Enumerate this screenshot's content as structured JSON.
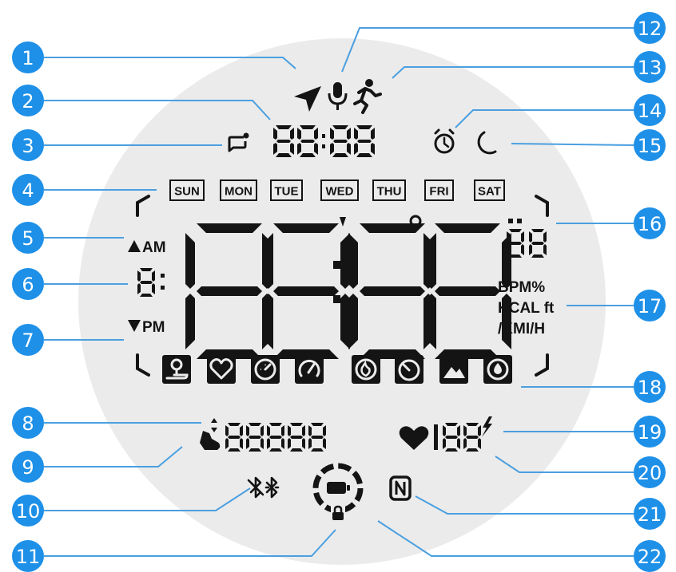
{
  "callouts": [
    {
      "num": "1"
    },
    {
      "num": "2"
    },
    {
      "num": "3"
    },
    {
      "num": "4"
    },
    {
      "num": "5"
    },
    {
      "num": "6"
    },
    {
      "num": "7"
    },
    {
      "num": "8"
    },
    {
      "num": "9"
    },
    {
      "num": "10"
    },
    {
      "num": "11"
    },
    {
      "num": "12"
    },
    {
      "num": "13"
    },
    {
      "num": "14"
    },
    {
      "num": "15"
    },
    {
      "num": "16"
    },
    {
      "num": "17"
    },
    {
      "num": "18"
    },
    {
      "num": "19"
    },
    {
      "num": "20"
    },
    {
      "num": "21"
    },
    {
      "num": "22"
    }
  ],
  "display": {
    "days": [
      "SUN",
      "MON",
      "TUE",
      "WED",
      "THU",
      "FRI",
      "SAT"
    ],
    "am": "AM",
    "pm": "PM",
    "units_line1": "BPM%",
    "units_line2": "KCAL ft",
    "units_line3": "/KMI/H"
  },
  "colors": {
    "badge": "#1E90E8",
    "callout_line": "#4A9FE0",
    "dial_bg": "#EBEBEB",
    "segment": "#141414"
  },
  "icons": {
    "top_row": [
      "navigation-arrow-icon",
      "microphone-icon",
      "running-person-icon"
    ],
    "notification": "notification-icon",
    "alarm": "alarm-clock-icon",
    "sleep": "moon-icon",
    "activity_row": [
      "route-icon",
      "heart-outline-icon",
      "timer-dial-icon",
      "speedometer-icon",
      "flame-icon",
      "stopwatch-icon",
      "mountain-icon",
      "water-drop-icon"
    ],
    "steps": "shoe-icon",
    "heart": "heart-icon",
    "charging": "lightning-icon",
    "bluetooth": [
      "bluetooth-icon",
      "bluetooth-low-energy-icon"
    ],
    "battery": "battery-ring-icon",
    "lock": "lock-icon",
    "nfc": "nfc-icon"
  }
}
